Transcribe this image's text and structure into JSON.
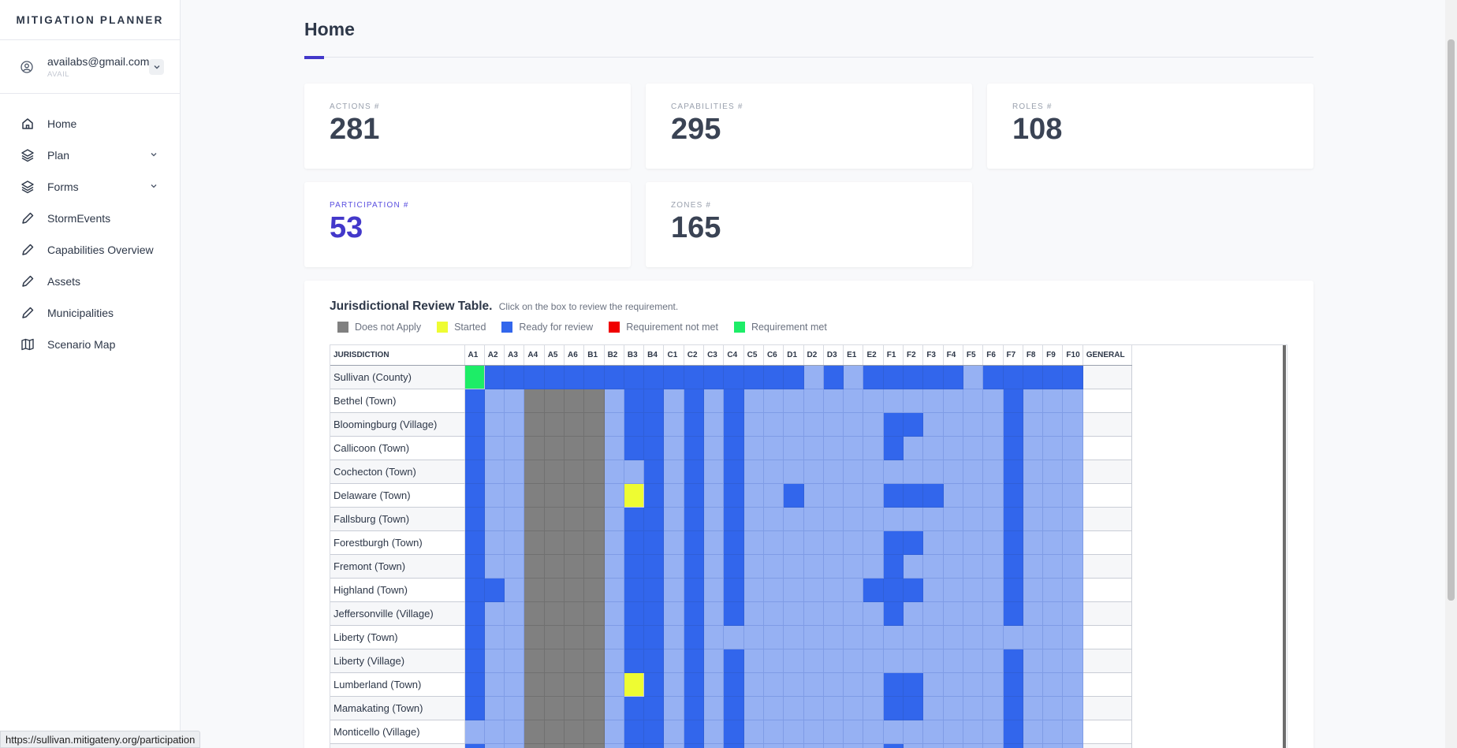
{
  "app": {
    "brand": "MITIGATION PLANNER"
  },
  "user": {
    "email": "availabs@gmail.com",
    "group": "AVAIL"
  },
  "sidebar": {
    "items": [
      {
        "label": "Home",
        "icon": "home-icon"
      },
      {
        "label": "Plan",
        "icon": "layers-icon",
        "expandable": true
      },
      {
        "label": "Forms",
        "icon": "layers-icon",
        "expandable": true
      },
      {
        "label": "StormEvents",
        "icon": "pencil-icon"
      },
      {
        "label": "Capabilities Overview",
        "icon": "pencil-icon"
      },
      {
        "label": "Assets",
        "icon": "pencil-icon"
      },
      {
        "label": "Municipalities",
        "icon": "pencil-icon"
      },
      {
        "label": "Scenario Map",
        "icon": "map-icon"
      }
    ]
  },
  "page": {
    "title": "Home"
  },
  "stats": [
    {
      "label": "ACTIONS #",
      "value": "281"
    },
    {
      "label": "CAPABILITIES #",
      "value": "295"
    },
    {
      "label": "ROLES #",
      "value": "108"
    },
    {
      "label": "PARTICIPATION #",
      "value": "53"
    },
    {
      "label": "ZONES #",
      "value": "165"
    }
  ],
  "review": {
    "title": "Jurisdictional Review Table.",
    "hint": "Click on the box to review the requirement.",
    "legend": [
      {
        "label": "Does not Apply",
        "color": "#808080"
      },
      {
        "label": "Started",
        "color": "#eefc32"
      },
      {
        "label": "Ready for review",
        "color": "#3266ec"
      },
      {
        "label": "Requirement not met",
        "color": "#f00000"
      },
      {
        "label": "Requirement met",
        "color": "#1ded67"
      }
    ],
    "jurisdiction_header": "JURISDICTION",
    "general_header": "GENERAL",
    "columns": [
      "A1",
      "A2",
      "A3",
      "A4",
      "A5",
      "A6",
      "B1",
      "B2",
      "B3",
      "B4",
      "C1",
      "C2",
      "C3",
      "C4",
      "C5",
      "C6",
      "D1",
      "D2",
      "D3",
      "E1",
      "E2",
      "F1",
      "F2",
      "F3",
      "F4",
      "F5",
      "F6",
      "F7",
      "F8",
      "F9",
      "F10"
    ],
    "status_key": {
      "x": "Does not Apply",
      "y": "Started",
      "r": "Ready for review",
      "n": "Requirement not met",
      "g": "Requirement met",
      "l": "light blue (not started)"
    },
    "rows": [
      {
        "name": "Sullivan (County)",
        "cells": "grrrrrrrrrrrrrrrrlrlrrrrrlrrrrr"
      },
      {
        "name": "Bethel (Town)",
        "cells": "rllxxxxlrrlrlrlllllllllllllrlll"
      },
      {
        "name": "Bloomingburg (Village)",
        "cells": "rllxxxxlrrlrlrlllllllrrllllrlll"
      },
      {
        "name": "Callicoon (Town)",
        "cells": "rllxxxxlrrlrlrlllllllrlllllrlll"
      },
      {
        "name": "Cochecton (Town)",
        "cells": "rllxxxxllrlrlrlllllllllllllrlll"
      },
      {
        "name": "Delaware (Town)",
        "cells": "rllxxxxlyrlrlrllrllllrrrlllrlll"
      },
      {
        "name": "Fallsburg (Town)",
        "cells": "rllxxxxlrrlrlrlllllllllllllrlll"
      },
      {
        "name": "Forestburgh (Town)",
        "cells": "rllxxxxlrrlrlrlllllllrrllllrlll"
      },
      {
        "name": "Fremont (Town)",
        "cells": "rllxxxxlrrlrlrlllllllrlllllrlll"
      },
      {
        "name": "Highland (Town)",
        "cells": "rrlxxxxlrrlrlrllllllrrrllllrlll"
      },
      {
        "name": "Jeffersonville (Village)",
        "cells": "rllxxxxlrrlrlrlllllllrlllllrlll"
      },
      {
        "name": "Liberty (Town)",
        "cells": "rllxxxxlrrlrllllllllllllllllll l"
      },
      {
        "name": "Liberty (Village)",
        "cells": "rllxxxxlrrlrlrlllllllllllllrlll"
      },
      {
        "name": "Lumberland (Town)",
        "cells": "rllxxxxlyrlrlrlllllllrrllllrlll"
      },
      {
        "name": "Mamakating (Town)",
        "cells": "rllxxxxlrrlrlrlllllllrrllllrlll"
      },
      {
        "name": "Monticello (Village)",
        "cells": "lllxxxxlrrlrlrlllllllllllllrlll"
      },
      {
        "name": "",
        "cells": "rllxxxxlrrlrlrlllllllrlllllrlll"
      }
    ]
  },
  "statusbar": {
    "url": "https://sullivan.mitigateny.org/participation"
  }
}
